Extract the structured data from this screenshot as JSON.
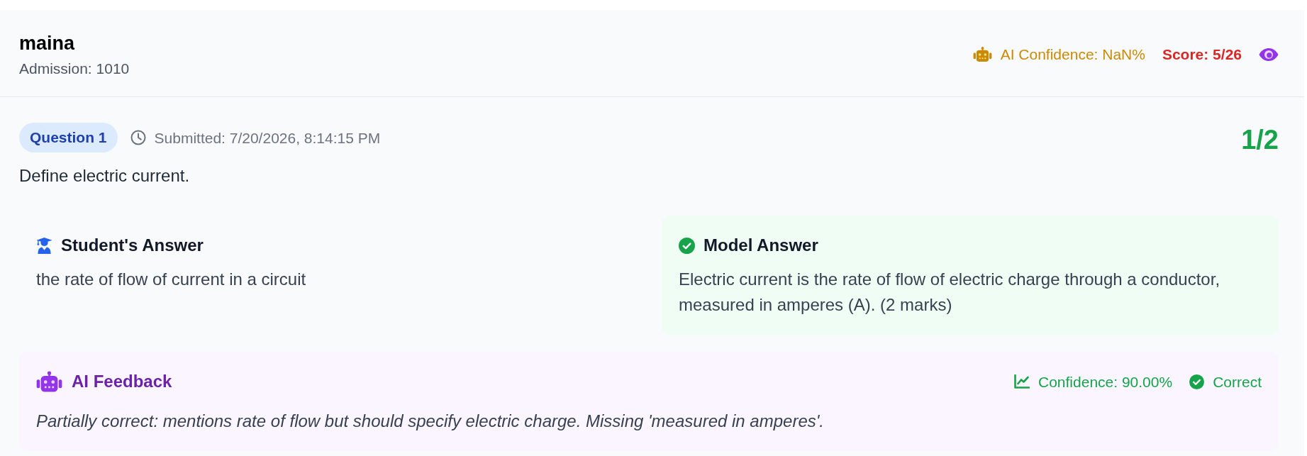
{
  "student": {
    "name": "maina",
    "admission": "Admission: 1010"
  },
  "summary": {
    "ai_confidence": "AI Confidence: NaN%",
    "score": "Score: 5/26"
  },
  "question": {
    "badge": "Question 1",
    "submitted": "Submitted: 7/20/2026, 8:14:15 PM",
    "marks": "1/2",
    "text": "Define electric current."
  },
  "answers": [
    {
      "kind": "student",
      "title": "Student's Answer",
      "text": "the rate of flow of current in a circuit"
    },
    {
      "kind": "model",
      "title": "Model Answer",
      "text": "Electric current is the rate of flow of electric charge through a conductor, measured in amperes (A). (2 marks)"
    }
  ],
  "feedback": {
    "title": "AI Feedback",
    "confidence": "Confidence: 90.00%",
    "verdict": {
      "label": "Correct",
      "correct": true
    },
    "text": "Partially correct: mentions rate of flow but should specify electric charge. Missing 'measured in amperes'."
  }
}
